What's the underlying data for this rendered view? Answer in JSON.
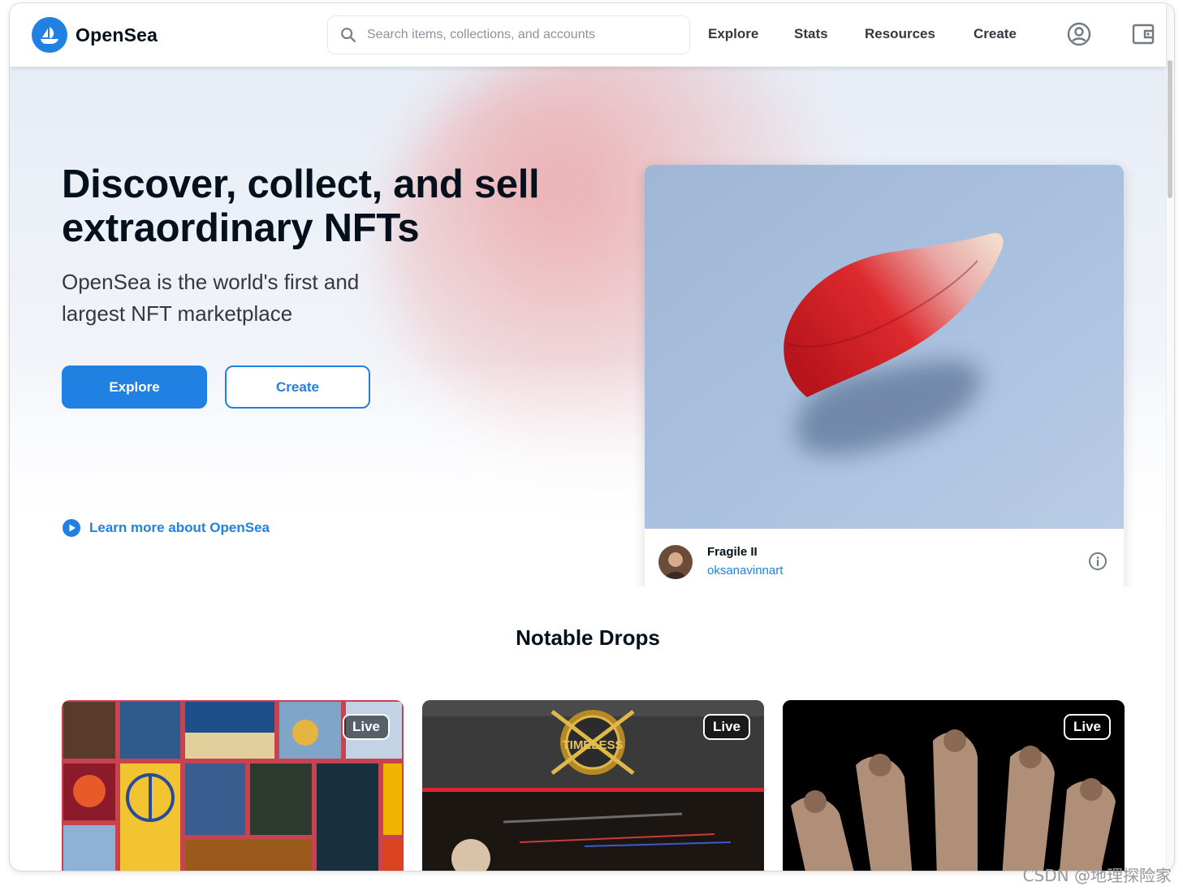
{
  "brand": {
    "name": "OpenSea",
    "accent_color": "#2081e2",
    "text_color": "#04111d"
  },
  "header": {
    "logo_icon": "opensea-ship-icon",
    "search": {
      "placeholder": "Search items, collections, and accounts",
      "value": ""
    },
    "nav": {
      "explore": "Explore",
      "stats": "Stats",
      "resources": "Resources",
      "create": "Create"
    },
    "icons": [
      "search-icon",
      "account-icon",
      "wallet-icon"
    ]
  },
  "hero": {
    "title": "Discover, collect, and sell extraordinary NFTs",
    "subtitle": "OpenSea is the world's first and largest NFT marketplace",
    "explore_button": "Explore",
    "create_button": "Create",
    "learn_more": "Learn more about OpenSea",
    "learn_more_icon": "play-circle-icon"
  },
  "featured": {
    "name": "Fragile II",
    "creator": "oksanavinnart",
    "info_icon": "info-icon"
  },
  "notable_drops": {
    "title": "Notable Drops",
    "items": [
      {
        "badge": "Live"
      },
      {
        "badge": "Live",
        "logo_text": "TIMELESS"
      },
      {
        "badge": "Live"
      }
    ]
  },
  "watermark": "CSDN @地理探险家"
}
